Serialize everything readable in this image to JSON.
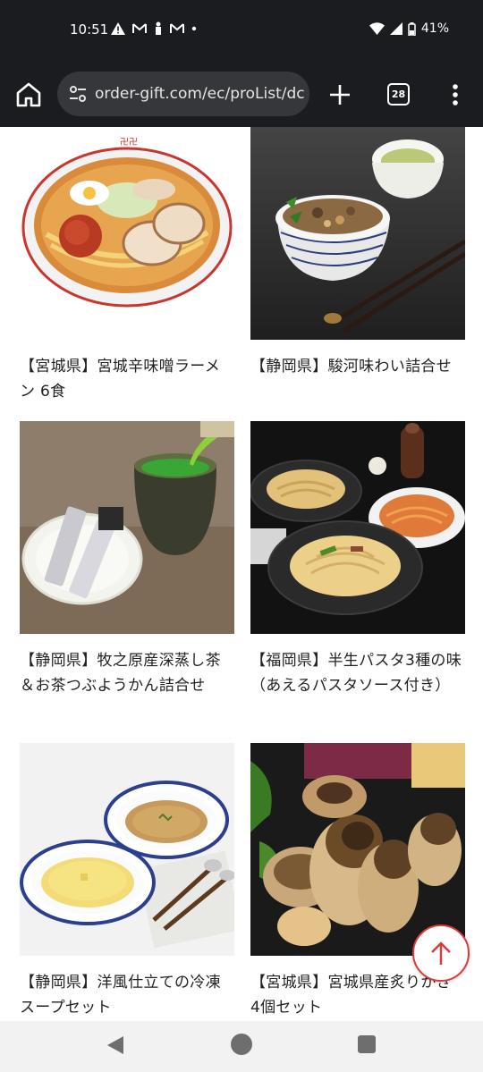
{
  "status_bar": {
    "time": "10:51",
    "notification_icons": [
      "warning-icon",
      "gmail-icon",
      "person-icon",
      "gmail-icon",
      "dot-icon"
    ],
    "battery": "41%"
  },
  "browser": {
    "url": "order-gift.com/ec/proList/dc",
    "tab_count": "28"
  },
  "products": [
    {
      "name": "【宮城県】宮城辛味噌ラーメン 6食",
      "image": "ramen-image"
    },
    {
      "name": "【静岡県】駿河味わい詰合せ",
      "image": "rice-bowl-image"
    },
    {
      "name": "【静岡県】牧之原産深蒸し茶＆お茶つぶようかん詰合せ",
      "image": "green-tea-image"
    },
    {
      "name": "【福岡県】半生パスタ3種の味（あえるパスタソース付き）",
      "image": "pasta-image"
    },
    {
      "name": "【静岡県】洋風仕立ての冷凍スープセット",
      "image": "soup-image"
    },
    {
      "name": "【宮城県】宮城県産炙りかき 4個セット",
      "image": "oyster-image"
    }
  ],
  "colors": {
    "browser_chrome": "#1b1c1f",
    "url_box": "#36373b",
    "scroll_top_accent": "#d93b3b"
  }
}
